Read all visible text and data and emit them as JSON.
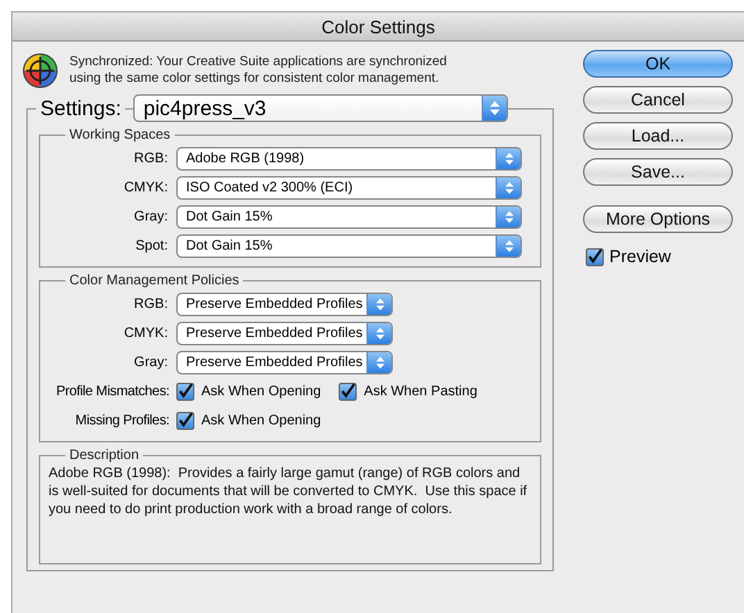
{
  "window": {
    "title": "Color Settings"
  },
  "sync_message": "Synchronized: Your Creative Suite applications are synchronized using the same color settings for consistent color management.",
  "settings": {
    "label": "Settings:",
    "value": "pic4press_v3"
  },
  "working_spaces": {
    "title": "Working Spaces",
    "rows": [
      {
        "label": "RGB:",
        "value": "Adobe RGB (1998)"
      },
      {
        "label": "CMYK:",
        "value": "ISO Coated v2 300% (ECI)"
      },
      {
        "label": "Gray:",
        "value": "Dot Gain 15%"
      },
      {
        "label": "Spot:",
        "value": "Dot Gain 15%"
      }
    ]
  },
  "policies": {
    "title": "Color Management Policies",
    "rows": [
      {
        "label": "RGB:",
        "value": "Preserve Embedded Profiles"
      },
      {
        "label": "CMYK:",
        "value": "Preserve Embedded Profiles"
      },
      {
        "label": "Gray:",
        "value": "Preserve Embedded Profiles"
      }
    ],
    "checks": [
      {
        "label": "Profile Mismatches:",
        "options": [
          {
            "label": "Ask When Opening",
            "checked": true
          },
          {
            "label": "Ask When Pasting",
            "checked": true
          }
        ]
      },
      {
        "label": "Missing Profiles:",
        "options": [
          {
            "label": "Ask When Opening",
            "checked": true
          }
        ]
      }
    ]
  },
  "description": {
    "title": "Description",
    "text": "Adobe RGB (1998):  Provides a fairly large gamut (range) of RGB colors and is well-suited for documents that will be converted to CMYK.  Use this space if you need to do print production work with a broad range of colors."
  },
  "buttons": [
    {
      "label": "OK",
      "default": true
    },
    {
      "label": "Cancel",
      "default": false
    },
    {
      "label": "Load...",
      "default": false
    },
    {
      "label": "Save...",
      "default": false
    },
    {
      "label": "More Options",
      "default": false
    }
  ],
  "preview": {
    "label": "Preview",
    "checked": true
  }
}
